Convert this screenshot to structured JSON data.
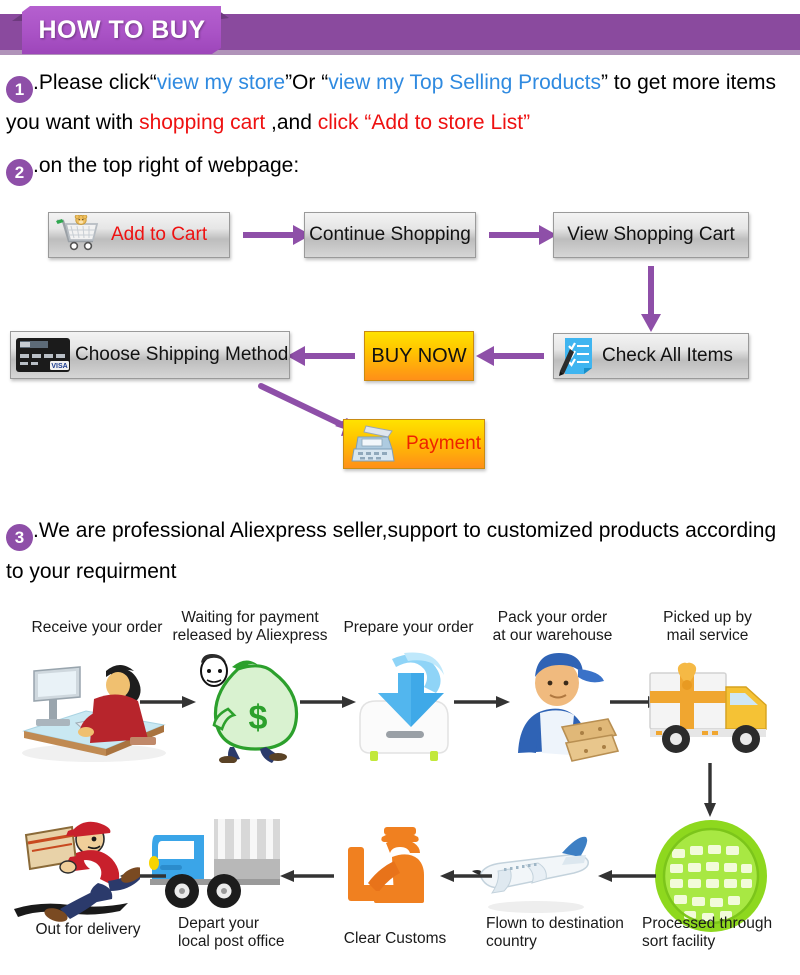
{
  "header": {
    "title": "HOW TO BUY",
    "ribbon_color": "#aa53c6",
    "bar_color": "#8a4a9e"
  },
  "steps": [
    {
      "number": "1",
      "segments": [
        {
          "text": ".Please click“",
          "color": "#000000"
        },
        {
          "text": "view my store",
          "color": "#2f8ae0"
        },
        {
          "text": "”Or “",
          "color": "#000000"
        },
        {
          "text": "view my Top Selling Products",
          "color": "#2f8ae0"
        },
        {
          "text": "” to get more items",
          "color": "#000000"
        }
      ]
    },
    {
      "number": "",
      "segments": [
        {
          "text": "you want with ",
          "color": "#000000"
        },
        {
          "text": "shopping cart",
          "color": "#ee1111"
        },
        {
          "text": " ,and ",
          "color": "#000000"
        },
        {
          "text": "click “Add to store List”",
          "color": "#ee1111"
        }
      ]
    },
    {
      "number": "2",
      "segments": [
        {
          "text": ".on the top right of webpage:",
          "color": "#000000"
        }
      ]
    },
    {
      "number": "3",
      "segments": [
        {
          "text": ".We are professional Aliexpress seller,support to customized products according",
          "color": "#000000"
        }
      ]
    },
    {
      "number": "",
      "segments": [
        {
          "text": "to your requirment",
          "color": "#000000"
        }
      ]
    }
  ],
  "flow": {
    "arrow_color": "#8e4fa8",
    "buttons": [
      {
        "id": "add-to-cart",
        "label": "Add to Cart",
        "icon": "shopping-cart-icon",
        "style": "gray-red-text"
      },
      {
        "id": "continue-shopping",
        "label": "Continue Shopping",
        "icon": "",
        "style": "gray"
      },
      {
        "id": "view-shopping-cart",
        "label": "View Shopping Cart",
        "icon": "",
        "style": "gray"
      },
      {
        "id": "check-all-items",
        "label": "Check All Items",
        "icon": "checklist-icon",
        "style": "gray"
      },
      {
        "id": "buy-now",
        "label": "BUY NOW",
        "icon": "",
        "style": "orange"
      },
      {
        "id": "choose-shipping-method",
        "label": "Choose Shipping Method",
        "icon": "credit-card-icon",
        "style": "gray"
      },
      {
        "id": "payment",
        "label": "Payment",
        "icon": "cash-register-icon",
        "style": "orange-red-text"
      }
    ]
  },
  "shipping": {
    "arrow_color": "#333333",
    "stages": [
      {
        "id": "receive-your-order",
        "caption": "Receive your order",
        "icon": "person-at-computer-icon"
      },
      {
        "id": "waiting-for-payment",
        "caption": "Waiting for payment\nreleased by Aliexpress",
        "icon": "money-bag-icon"
      },
      {
        "id": "prepare-your-order",
        "caption": "Prepare your order",
        "icon": "download-box-icon"
      },
      {
        "id": "pack-your-order",
        "caption": "Pack your order\nat our warehouse",
        "icon": "worker-packing-icon"
      },
      {
        "id": "picked-up-by-mail-service",
        "caption": "Picked up by\nmail service",
        "icon": "delivery-truck-icon"
      },
      {
        "id": "processed-through-sort-facility",
        "caption": "Processed through\nsort facility",
        "icon": "green-globe-icon"
      },
      {
        "id": "flown-to-destination-country",
        "caption": "Flown to destination\ncountry",
        "icon": "airplane-icon"
      },
      {
        "id": "clear-customs",
        "caption": "Clear Customs",
        "icon": "customs-officer-icon"
      },
      {
        "id": "depart-your-local-post-office",
        "caption": "Depart your\nlocal post office",
        "icon": "blue-truck-icon"
      },
      {
        "id": "out-for-delivery",
        "caption": "Out for delivery",
        "icon": "running-courier-icon"
      }
    ]
  }
}
